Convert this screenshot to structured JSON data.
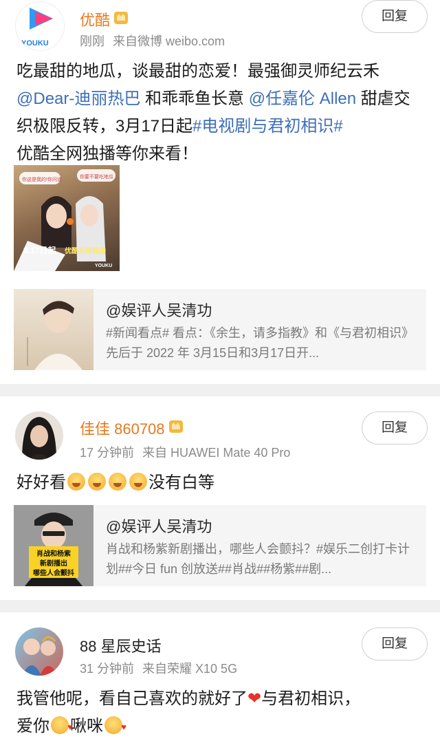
{
  "post1": {
    "user": "优酷",
    "avatar_logo": "YOUKU",
    "time": "刚刚",
    "source": "来自微博 weibo.com",
    "reply_label": "回复",
    "text_parts": [
      "吃最甜的地瓜，谈最甜的恋爱！最强御灵师纪云禾",
      "@Dear-迪丽热巴",
      " 和乖乖鱼长意 ",
      "@任嘉伦 Allen",
      " 甜虐交织极限反转，3月17日起",
      "#电视剧与君初相识#",
      "优酷全网独播等你来看！"
    ],
    "image": {
      "bubble1": "你这是我的!你问道",
      "bubble2": "你要不要吃地瓜",
      "date_text": "3.17日起",
      "platform_text": "优酷全网独播",
      "brand": "YOUKU"
    },
    "quote": {
      "title": "@娱评人吴清功",
      "text": "#新闻看点# 看点：《余生，请多指教》和《与君初相识》先后于 2022 年 3月15日和3月17日开..."
    }
  },
  "post2": {
    "user": "佳佳 860708",
    "time": "17 分钟前",
    "source": "来自 HUAWEI Mate 40 Pro",
    "reply_label": "回复",
    "text_before": "好好看",
    "text_after": "没有白等",
    "quote": {
      "title": "@娱评人吴清功",
      "text": "肖战和杨紫新剧播出，哪些人会颤抖？#娱乐二创打卡计划##今日 fun 创放送##肖战##杨紫##剧...",
      "thumb_caption": [
        "肖战和杨紫",
        "新剧播出",
        "哪些人会颤抖"
      ]
    }
  },
  "post3": {
    "user": "88 星辰史话",
    "time": "31 分钟前",
    "source": "来自荣耀 X10 5G",
    "reply_label": "回复",
    "text_a": "我管他呢，看自己喜欢的就好了",
    "text_b": "与君初相识，",
    "text_c": "爱你",
    "text_d": "啾咪"
  },
  "colors": {
    "username": "#e67a1e",
    "link": "#3d6fb8",
    "separator": "#f0f0f0"
  }
}
